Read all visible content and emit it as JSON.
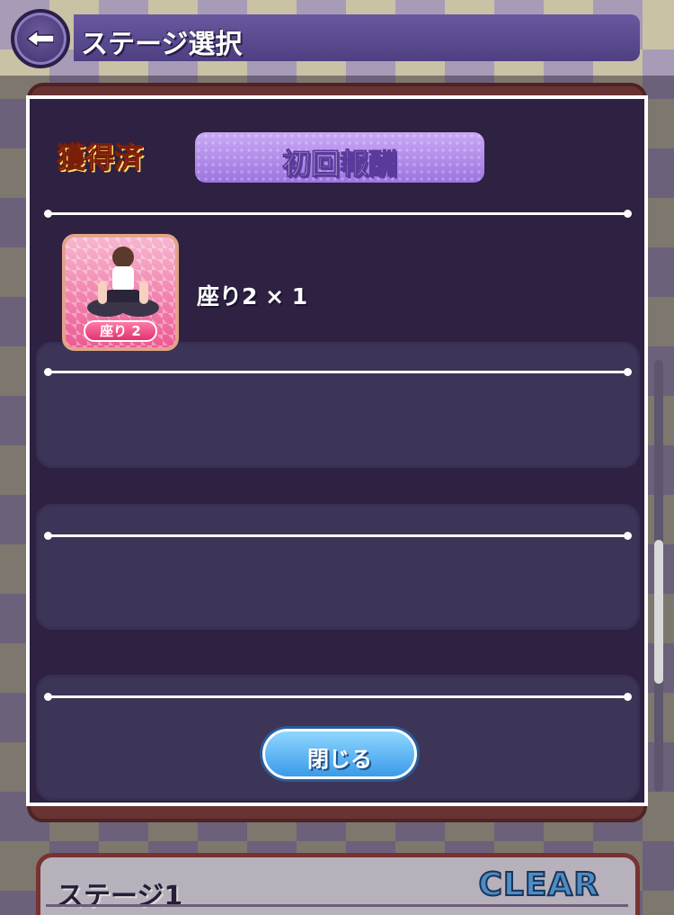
{
  "header": {
    "title": "ステージ選択"
  },
  "stage_list": {
    "stage1_title": "ステージ1",
    "clear_label": "CLEAR"
  },
  "modal": {
    "acquired_label": "獲得済",
    "title": "初回報酬",
    "reward": {
      "badge": "座り 2",
      "text": "座り2 × 1"
    },
    "close_label": "閉じる"
  },
  "colors": {
    "modal_bg": "#251e44",
    "pill": "#b58eeb",
    "acquired": "#ff5a2a",
    "close_button": "#3a9be8"
  },
  "icons": {
    "back": "back-arrow-icon"
  }
}
